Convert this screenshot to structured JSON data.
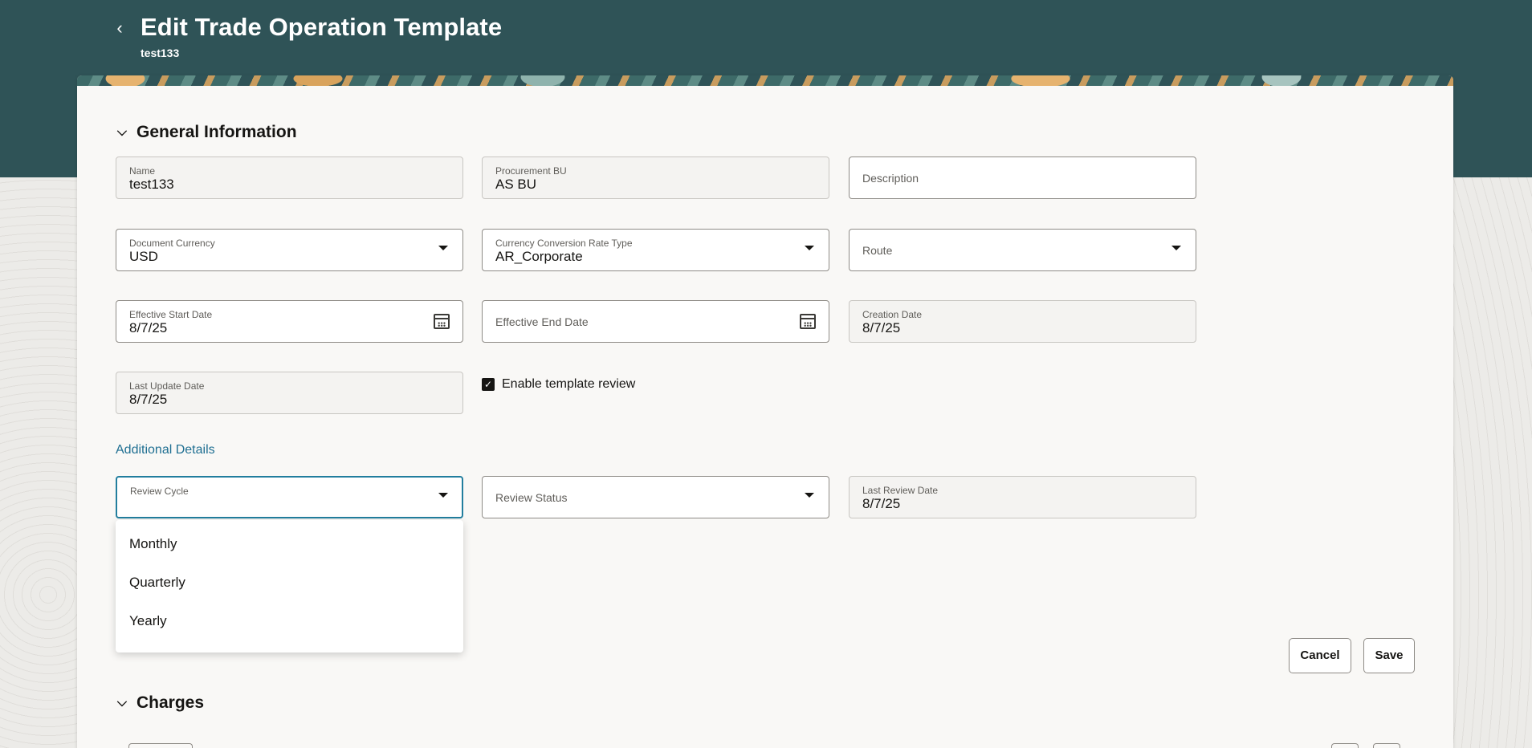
{
  "header": {
    "title": "Edit Trade Operation Template",
    "subtitle": "test133",
    "back_icon": "chevron-left-icon"
  },
  "general_information": {
    "title": "General Information",
    "fields": {
      "name": {
        "label": "Name",
        "value": "test133"
      },
      "procurement_bu": {
        "label": "Procurement BU",
        "value": "AS BU"
      },
      "description": {
        "placeholder": "Description"
      },
      "document_currency": {
        "label": "Document Currency",
        "value": "USD"
      },
      "currency_conversion_rate_type": {
        "label": "Currency Conversion Rate Type",
        "value": "AR_Corporate"
      },
      "route": {
        "placeholder": "Route"
      },
      "effective_start_date": {
        "label": "Effective Start Date",
        "value": "8/7/25"
      },
      "effective_end_date": {
        "placeholder": "Effective End Date"
      },
      "creation_date": {
        "label": "Creation Date",
        "value": "8/7/25"
      },
      "last_update_date": {
        "label": "Last Update Date",
        "value": "8/7/25"
      }
    },
    "enable_template_review": {
      "label": "Enable template review",
      "checked": true
    }
  },
  "additional_details": {
    "title": "Additional Details",
    "review_cycle": {
      "label": "Review Cycle",
      "value": ""
    },
    "review_status": {
      "placeholder": "Review Status"
    },
    "last_review_date": {
      "label": "Last Review Date",
      "value": "8/7/25"
    },
    "review_cycle_options": [
      "Monthly",
      "Quarterly",
      "Yearly"
    ]
  },
  "actions": {
    "cancel_label": "Cancel",
    "save_label": "Save"
  },
  "charges": {
    "title": "Charges"
  },
  "colors": {
    "header_bg": "#2f5357",
    "link": "#1f6f92",
    "focus": "#227e9e"
  }
}
